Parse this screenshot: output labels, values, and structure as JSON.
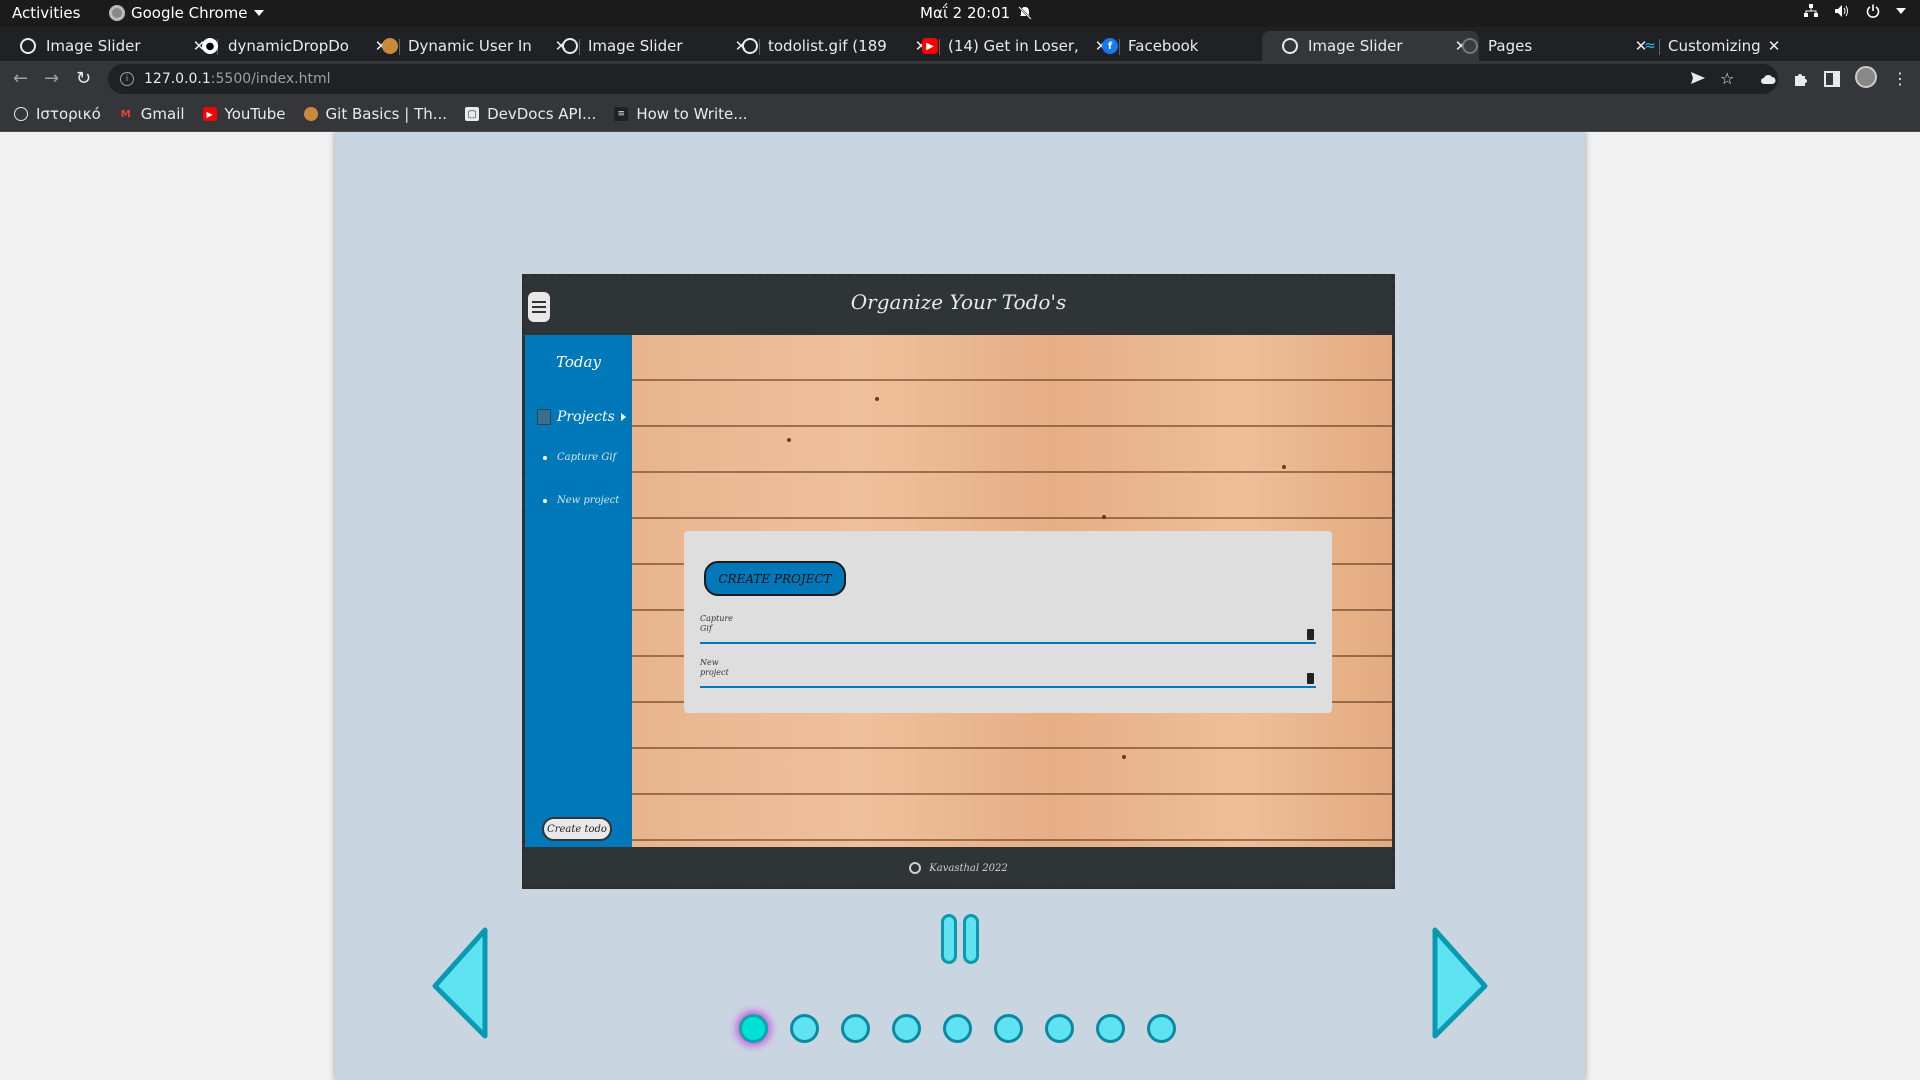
{
  "system": {
    "activities": "Activities",
    "app_name": "Google Chrome",
    "datetime": "Μαΐ 2  20:01"
  },
  "tabs": [
    {
      "title": "Image Slider",
      "favicon": "globe-icon",
      "active": false
    },
    {
      "title": "dynamicDropDo",
      "favicon": "github-icon",
      "active": false
    },
    {
      "title": "Dynamic User In",
      "favicon": "odin-icon",
      "active": false
    },
    {
      "title": "Image Slider",
      "favicon": "globe-icon",
      "active": false
    },
    {
      "title": "todolist.gif (189",
      "favicon": "globe-icon",
      "active": false
    },
    {
      "title": "(14) Get in Loser,",
      "favicon": "youtube-icon",
      "active": false
    },
    {
      "title": "Facebook",
      "favicon": "facebook-icon",
      "active": false
    },
    {
      "title": "Image Slider",
      "favicon": "globe-icon",
      "active": true
    },
    {
      "title": "Pages",
      "favicon": "github-icon",
      "active": false
    },
    {
      "title": "Customizing Co",
      "favicon": "tailwind-icon",
      "active": false
    }
  ],
  "address_bar": {
    "host": "127.0.0.1",
    "path": ":5500/index.html"
  },
  "bookmarks": [
    {
      "label": "Ιστορικό",
      "icon": "history-icon"
    },
    {
      "label": "Gmail",
      "icon": "gmail-icon"
    },
    {
      "label": "YouTube",
      "icon": "youtube-icon"
    },
    {
      "label": "Git Basics | Th...",
      "icon": "odin-icon"
    },
    {
      "label": "DevDocs API...",
      "icon": "devdocs-icon"
    },
    {
      "label": "How to Write...",
      "icon": "document-icon"
    }
  ],
  "slide": {
    "app_title": "Organize Your Todo's",
    "sidebar_today": "Today",
    "sidebar_projects": "Projects",
    "sidebar_items": [
      "Capture Gif",
      "New project"
    ],
    "create_todo": "Create todo",
    "create_project": "CREATE PROJECT",
    "project_rows": [
      "Capture Gif",
      "New project"
    ],
    "footer": "Kavasthal 2022"
  },
  "slider": {
    "dot_count": 9,
    "active_index": 0
  },
  "colors": {
    "accent": "#5fe3f2",
    "active_dot": "#00e0d4",
    "page_bg": "#cad5e2",
    "todo_blue": "#0178b9"
  }
}
